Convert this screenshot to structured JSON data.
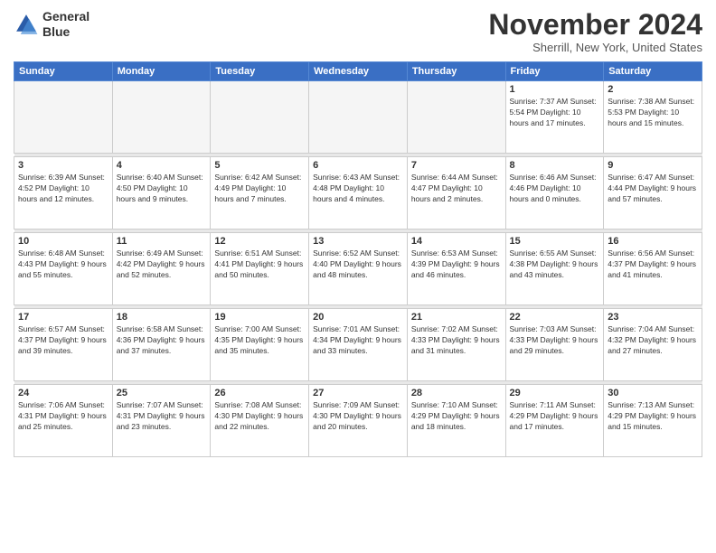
{
  "header": {
    "logo_line1": "General",
    "logo_line2": "Blue",
    "month": "November 2024",
    "location": "Sherrill, New York, United States"
  },
  "days_of_week": [
    "Sunday",
    "Monday",
    "Tuesday",
    "Wednesday",
    "Thursday",
    "Friday",
    "Saturday"
  ],
  "weeks": [
    [
      {
        "day": "",
        "info": ""
      },
      {
        "day": "",
        "info": ""
      },
      {
        "day": "",
        "info": ""
      },
      {
        "day": "",
        "info": ""
      },
      {
        "day": "",
        "info": ""
      },
      {
        "day": "1",
        "info": "Sunrise: 7:37 AM\nSunset: 5:54 PM\nDaylight: 10 hours and 17 minutes."
      },
      {
        "day": "2",
        "info": "Sunrise: 7:38 AM\nSunset: 5:53 PM\nDaylight: 10 hours and 15 minutes."
      }
    ],
    [
      {
        "day": "3",
        "info": "Sunrise: 6:39 AM\nSunset: 4:52 PM\nDaylight: 10 hours and 12 minutes."
      },
      {
        "day": "4",
        "info": "Sunrise: 6:40 AM\nSunset: 4:50 PM\nDaylight: 10 hours and 9 minutes."
      },
      {
        "day": "5",
        "info": "Sunrise: 6:42 AM\nSunset: 4:49 PM\nDaylight: 10 hours and 7 minutes."
      },
      {
        "day": "6",
        "info": "Sunrise: 6:43 AM\nSunset: 4:48 PM\nDaylight: 10 hours and 4 minutes."
      },
      {
        "day": "7",
        "info": "Sunrise: 6:44 AM\nSunset: 4:47 PM\nDaylight: 10 hours and 2 minutes."
      },
      {
        "day": "8",
        "info": "Sunrise: 6:46 AM\nSunset: 4:46 PM\nDaylight: 10 hours and 0 minutes."
      },
      {
        "day": "9",
        "info": "Sunrise: 6:47 AM\nSunset: 4:44 PM\nDaylight: 9 hours and 57 minutes."
      }
    ],
    [
      {
        "day": "10",
        "info": "Sunrise: 6:48 AM\nSunset: 4:43 PM\nDaylight: 9 hours and 55 minutes."
      },
      {
        "day": "11",
        "info": "Sunrise: 6:49 AM\nSunset: 4:42 PM\nDaylight: 9 hours and 52 minutes."
      },
      {
        "day": "12",
        "info": "Sunrise: 6:51 AM\nSunset: 4:41 PM\nDaylight: 9 hours and 50 minutes."
      },
      {
        "day": "13",
        "info": "Sunrise: 6:52 AM\nSunset: 4:40 PM\nDaylight: 9 hours and 48 minutes."
      },
      {
        "day": "14",
        "info": "Sunrise: 6:53 AM\nSunset: 4:39 PM\nDaylight: 9 hours and 46 minutes."
      },
      {
        "day": "15",
        "info": "Sunrise: 6:55 AM\nSunset: 4:38 PM\nDaylight: 9 hours and 43 minutes."
      },
      {
        "day": "16",
        "info": "Sunrise: 6:56 AM\nSunset: 4:37 PM\nDaylight: 9 hours and 41 minutes."
      }
    ],
    [
      {
        "day": "17",
        "info": "Sunrise: 6:57 AM\nSunset: 4:37 PM\nDaylight: 9 hours and 39 minutes."
      },
      {
        "day": "18",
        "info": "Sunrise: 6:58 AM\nSunset: 4:36 PM\nDaylight: 9 hours and 37 minutes."
      },
      {
        "day": "19",
        "info": "Sunrise: 7:00 AM\nSunset: 4:35 PM\nDaylight: 9 hours and 35 minutes."
      },
      {
        "day": "20",
        "info": "Sunrise: 7:01 AM\nSunset: 4:34 PM\nDaylight: 9 hours and 33 minutes."
      },
      {
        "day": "21",
        "info": "Sunrise: 7:02 AM\nSunset: 4:33 PM\nDaylight: 9 hours and 31 minutes."
      },
      {
        "day": "22",
        "info": "Sunrise: 7:03 AM\nSunset: 4:33 PM\nDaylight: 9 hours and 29 minutes."
      },
      {
        "day": "23",
        "info": "Sunrise: 7:04 AM\nSunset: 4:32 PM\nDaylight: 9 hours and 27 minutes."
      }
    ],
    [
      {
        "day": "24",
        "info": "Sunrise: 7:06 AM\nSunset: 4:31 PM\nDaylight: 9 hours and 25 minutes."
      },
      {
        "day": "25",
        "info": "Sunrise: 7:07 AM\nSunset: 4:31 PM\nDaylight: 9 hours and 23 minutes."
      },
      {
        "day": "26",
        "info": "Sunrise: 7:08 AM\nSunset: 4:30 PM\nDaylight: 9 hours and 22 minutes."
      },
      {
        "day": "27",
        "info": "Sunrise: 7:09 AM\nSunset: 4:30 PM\nDaylight: 9 hours and 20 minutes."
      },
      {
        "day": "28",
        "info": "Sunrise: 7:10 AM\nSunset: 4:29 PM\nDaylight: 9 hours and 18 minutes."
      },
      {
        "day": "29",
        "info": "Sunrise: 7:11 AM\nSunset: 4:29 PM\nDaylight: 9 hours and 17 minutes."
      },
      {
        "day": "30",
        "info": "Sunrise: 7:13 AM\nSunset: 4:29 PM\nDaylight: 9 hours and 15 minutes."
      }
    ]
  ]
}
